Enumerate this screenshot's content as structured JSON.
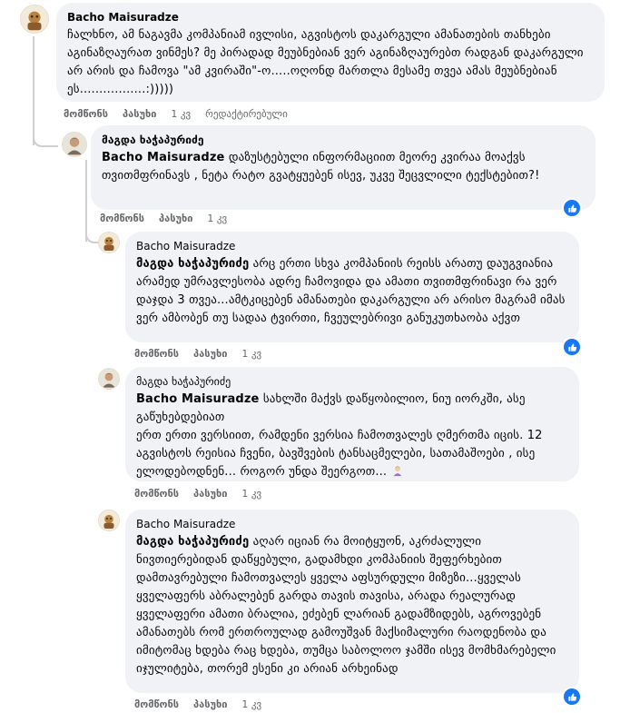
{
  "comments": [
    {
      "author": "Bacho Maisuradze",
      "text": "ჩალხნო, ამ ნაგავმა კომპანიამ ივლისი, აგვისტოს დაკარგული ამანათების თანხები აგინაზღაურათ ვინმეს? მე პირადად მეუბნებიან ვერ აგინაზღაურებთ რადგან დაკარგული არ არის და ჩამოვა \"ამ კვირაში\"-ო.....ოღონდ მართლა მესამე თვეა ამას მეუბნებიან ეს.................:)))))",
      "actions": {
        "like": "მომწონს",
        "reply": "პასუხი",
        "time": "1 კვ",
        "edited": "რედაქტირებული"
      }
    },
    {
      "author": "მაგდა ხაჭაპურიძე",
      "tag": "Bacho Maisuradze",
      "text": " დაზუსტებული ინფორმაციით მეორე კვირაა მოაქვს თვითმფრინავს , ნეტა რატო გვატყუებენ ისევ, უკვე შეცვლილი ტექსტებით?!",
      "actions": {
        "like": "მომწონს",
        "reply": "პასუხი",
        "time": "1 კვ"
      }
    },
    {
      "author": "Bacho Maisuradze",
      "tag": "მაგდა ხაჭაპურიძე",
      "text": " არც ერთი სხვა კომპანიის რეისს არათუ დაუგვიანია არამედ უმრავლესობა ადრე ჩამოვიდა და ამათი თვითმფრინავი რა ვერ დაჯდა 3 თვეა...ამტკიცებენ ამანათები დაკარგული არ არისო მაგრამ იმას ვერ ამბობენ თუ სადაა ტვირთი, ჩვეულებრივი განუკუთხაობა აქვთ",
      "actions": {
        "like": "მომწონს",
        "reply": "პასუხი",
        "time": "1 კვ"
      }
    },
    {
      "author": "მაგდა ხაჭაპურიძე",
      "tag": "Bacho Maisuradze",
      "text1": " სახლში მაქვს დაწყობილიო, ნიუ იორკში, ასე გაწუხებდებიათ",
      "text2": "ერთ ერთი ვერსიით, რამდენი ვერსია ჩამოთვალეს ღმერთმა იცის. 12 აგვისტოს რეისია ჩვენი, ბავშვების ტანსაცმელები, სათამაშოები , ისე ელოდებოდნენ... როგორ უნდა შეერგოთ...",
      "actions": {
        "like": "მომწონს",
        "reply": "პასუხი",
        "time": "1 კვ"
      }
    },
    {
      "author": "Bacho Maisuradze",
      "tag": "მაგდა ხაჭაპურიძე",
      "text": " აღარ იციან რა მოიტყუონ, აკრძალული ნივთიერებიდან დაწყებული, გადამხდი კომპანიის შეფერხებით დამთავრებული ჩამოთვალეს ყველა აფსურდული მიზეზი...ყველას ყველაფერს აბრალებენ გარდა თავის თავისა, არადა რეალურად ყველაფერი ამათი ბრალია, ეძებენ ლარიან გადამზიდებს, აგროვებენ ამანათებს რომ ერთროულად გამოუშვან მაქსიმალური რაოდენობა და იმიტომაც ხდება რაც ხდება, თუმცა საბოლოო ჯამში ისევ მომხმარებელი იჯულიტება, თორემ ესენი კი არიან არხეინად",
      "actions": {
        "like": "მომწონს",
        "reply": "პასუხი",
        "time": "1 კვ"
      }
    }
  ]
}
